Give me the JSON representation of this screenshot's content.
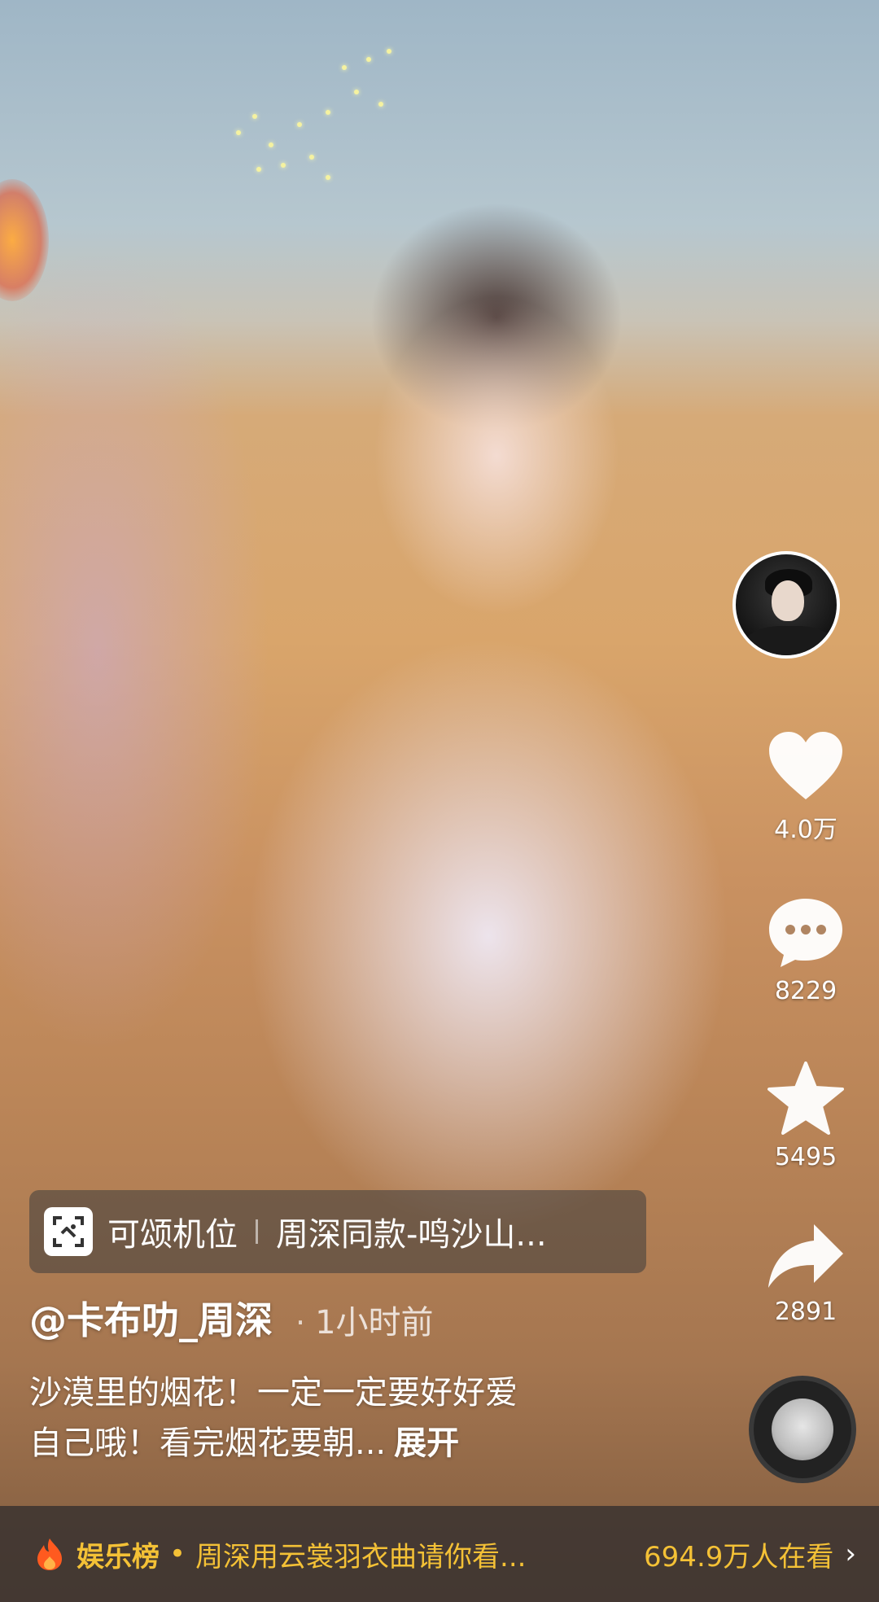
{
  "video": {
    "description": ""
  },
  "rail": {
    "likes": "4.0万",
    "comments": "8229",
    "favorites": "5495",
    "shares": "2891"
  },
  "template": {
    "label": "可颂机位",
    "name": "周深同款-鸣沙山..."
  },
  "post": {
    "author": "@卡布叻_周深",
    "time": "1小时前",
    "caption_line1": "沙漠里的烟花！一定一定要好好爱",
    "caption_line2": "自己哦！看完烟花要朝...",
    "expand": "展开"
  },
  "bottom": {
    "board": "娱乐榜",
    "separator": "•",
    "topic": "周深用云裳羽衣曲请你看...",
    "viewers": "694.9万人在看",
    "chevron": "›"
  },
  "colors": {
    "accent": "#f4c136",
    "fire": "#ff5a1f"
  },
  "icons": [
    "heart-icon",
    "comment-icon",
    "star-icon",
    "share-icon",
    "scan-icon",
    "fire-icon",
    "chevron-right-icon"
  ]
}
